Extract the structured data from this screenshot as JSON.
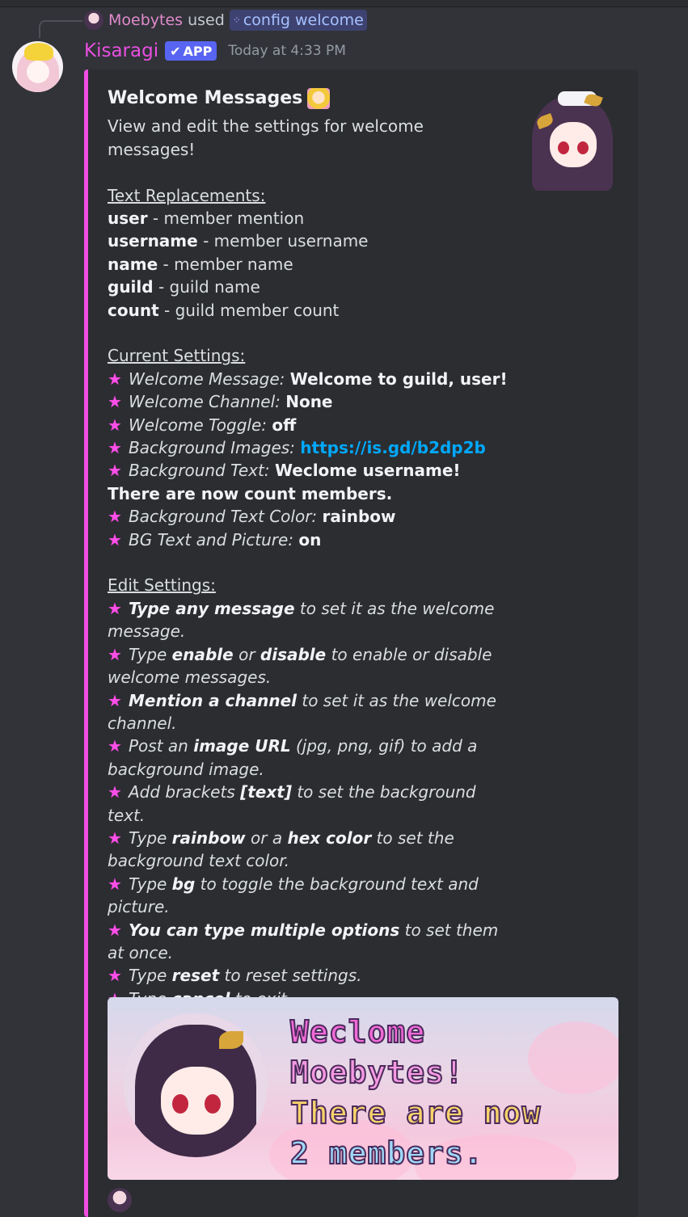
{
  "reply": {
    "user": "Moebytes",
    "used": "used",
    "command": "config welcome"
  },
  "message": {
    "author": "Kisaragi",
    "badge": "APP",
    "timestamp": "Today at 4:33 PM"
  },
  "embed": {
    "title": "Welcome Messages",
    "description": "View and edit the settings for welcome messages!",
    "replacements_header": "Text Replacements:",
    "replacements": [
      {
        "key": "user",
        "desc": " - member mention"
      },
      {
        "key": "username",
        "desc": " - member username"
      },
      {
        "key": "name",
        "desc": " - member name"
      },
      {
        "key": "guild",
        "desc": " - guild name"
      },
      {
        "key": "count",
        "desc": " - guild member count"
      }
    ],
    "current_header": "Current Settings:",
    "settings": {
      "welcome_message_label": "Welcome Message: ",
      "welcome_message_value": "Welcome to guild, user!",
      "welcome_channel_label": "Welcome Channel: ",
      "welcome_channel_value": "None",
      "welcome_toggle_label": "Welcome Toggle: ",
      "welcome_toggle_value": "off",
      "bg_images_label": "Background Images: ",
      "bg_images_value": "https://is.gd/b2dp2b",
      "bg_text_label": "Background Text: ",
      "bg_text_value": "Weclome username! There are now count members.",
      "bg_color_label": "Background Text Color: ",
      "bg_color_value": "rainbow",
      "bg_pic_label": "BG Text and Picture: ",
      "bg_pic_value": "on"
    },
    "edit_header": "Edit Settings:",
    "edit": {
      "e1_b": "Type any message",
      "e1_t": " to set it as the welcome message.",
      "e2_a": "Type ",
      "e2_b1": "enable",
      "e2_c": " or ",
      "e2_b2": "disable",
      "e2_t": " to enable or disable welcome messages.",
      "e3_b": "Mention a channel",
      "e3_t": " to set it as the welcome channel.",
      "e4_a": "Post an ",
      "e4_b": "image URL",
      "e4_t": " (jpg, png, gif) to add a background image.",
      "e5_a": "Add brackets ",
      "e5_b": "[text]",
      "e5_t": " to set the background text.",
      "e6_a": "Type ",
      "e6_b1": "rainbow",
      "e6_c": " or a ",
      "e6_b2": "hex color",
      "e6_t": " to set the background text color.",
      "e7_a": "Type ",
      "e7_b": "bg",
      "e7_t": " to toggle the background text and picture.",
      "e8_b": "You can type multiple options",
      "e8_t": " to set them at once.",
      "e9_a": "Type ",
      "e9_b": "reset",
      "e9_t": " to reset settings.",
      "e10_a": "Type ",
      "e10_b": "cancel",
      "e10_t": " to exit."
    },
    "banner_lines": [
      {
        "text": "Weclome",
        "color": "#f36ad8"
      },
      {
        "text": "Moebytes!",
        "color": "#f59ae0"
      },
      {
        "text": "There are now",
        "color": "#f7d36b"
      },
      {
        "text": "2 members.",
        "color": "#9fd8f7"
      }
    ]
  },
  "colors": {
    "accent": "#f14de1",
    "username": "#e84fe0",
    "link": "#00a8fc",
    "app_badge": "#5865f2"
  }
}
